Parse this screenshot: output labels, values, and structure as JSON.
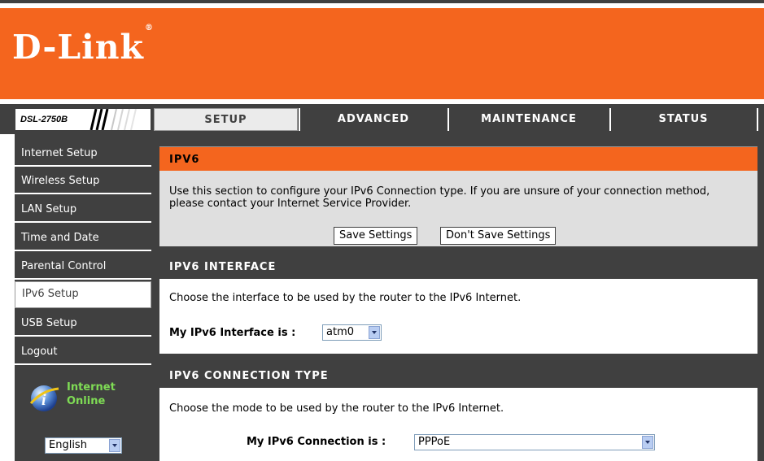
{
  "brand": {
    "logo": "D-Link",
    "registered": "®",
    "model": "DSL-2750B"
  },
  "tabs": [
    {
      "label": "SETUP",
      "active": true
    },
    {
      "label": "ADVANCED",
      "active": false
    },
    {
      "label": "MAINTENANCE",
      "active": false
    },
    {
      "label": "STATUS",
      "active": false
    }
  ],
  "sidebar": {
    "items": [
      {
        "label": "Internet Setup"
      },
      {
        "label": "Wireless Setup"
      },
      {
        "label": "LAN Setup"
      },
      {
        "label": "Time and Date"
      },
      {
        "label": "Parental Control"
      },
      {
        "label": "IPv6 Setup",
        "active": true
      },
      {
        "label": "USB Setup"
      },
      {
        "label": "Logout"
      }
    ],
    "status_line1": "Internet",
    "status_line2": "Online",
    "language": "English"
  },
  "ipv6": {
    "title": "IPV6",
    "description": "Use this section to configure your IPv6 Connection type. If you are unsure of your connection method, please contact your Internet Service Provider.",
    "save_label": "Save Settings",
    "dont_save_label": "Don't Save Settings"
  },
  "interface": {
    "title": "IPV6 INTERFACE",
    "description": "Choose the interface to be used by the router to the IPv6 Internet.",
    "field_label": "My IPv6 Interface is :",
    "value": "atm0"
  },
  "connection": {
    "title": "IPV6 CONNECTION TYPE",
    "description": "Choose the mode to be used by the router to the IPv6 Internet.",
    "field_label": "My IPv6 Connection is :",
    "value": "PPPoE"
  },
  "colors": {
    "brand_orange": "#f4651e",
    "nav_dark": "#404040",
    "status_green": "#7fdc55"
  },
  "icons": [
    "internet-status-globe-icon",
    "dropdown-arrow-icon"
  ]
}
